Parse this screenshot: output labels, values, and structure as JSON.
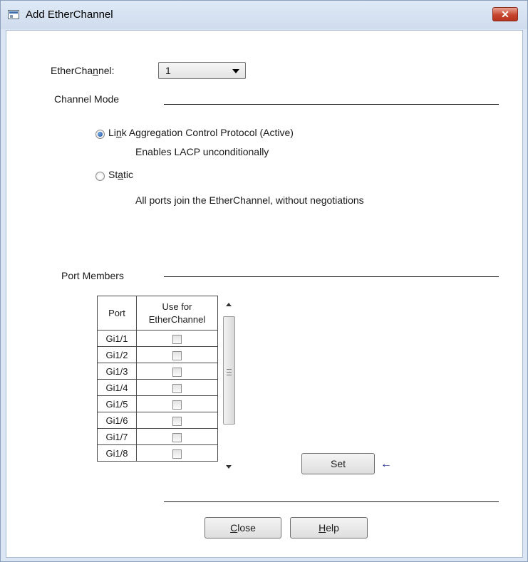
{
  "window": {
    "title": "Add EtherChannel",
    "close_label": "✕"
  },
  "etherchannel": {
    "label_pre": "EtherCha",
    "label_mn": "n",
    "label_post": "nel:",
    "selected_value": "1"
  },
  "channel_mode": {
    "label": "Channel Mode",
    "options": [
      {
        "label_pre": "Li",
        "label_mn": "n",
        "label_post": "k Aggregation Control Protocol (Active)",
        "description": "Enables LACP unconditionally",
        "selected": true
      },
      {
        "label_pre": "St",
        "label_mn": "a",
        "label_post": "tic",
        "description": "All ports join the EtherChannel, without negotiations",
        "selected": false
      }
    ]
  },
  "port_members": {
    "label": "Port Members",
    "columns": {
      "port": "Port",
      "use_line1": "Use for",
      "use_line2": "EtherChannel"
    },
    "rows": [
      {
        "port": "Gi1/1",
        "use": false
      },
      {
        "port": "Gi1/2",
        "use": false
      },
      {
        "port": "Gi1/3",
        "use": false
      },
      {
        "port": "Gi1/4",
        "use": false
      },
      {
        "port": "Gi1/5",
        "use": false
      },
      {
        "port": "Gi1/6",
        "use": false
      },
      {
        "port": "Gi1/7",
        "use": false
      },
      {
        "port": "Gi1/8",
        "use": false
      }
    ]
  },
  "set_button": {
    "label": "Set"
  },
  "indicator_arrow": "←",
  "footer": {
    "close_mn": "C",
    "close_rest": "lose",
    "help_mn": "H",
    "help_rest": "elp"
  }
}
